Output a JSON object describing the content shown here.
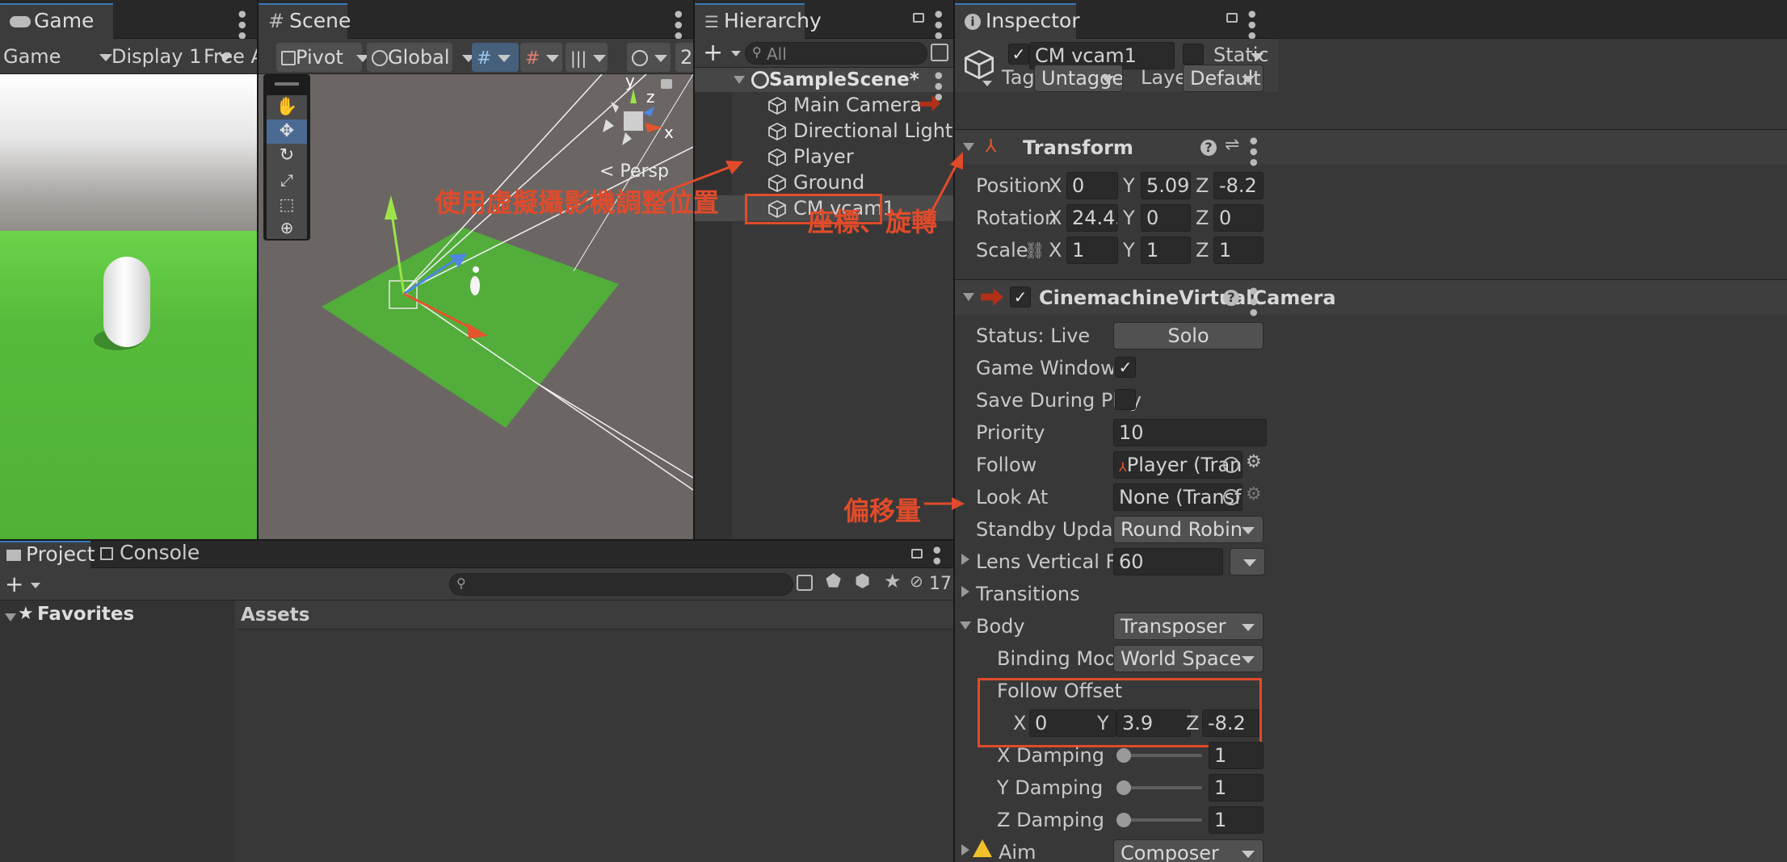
{
  "game": {
    "tab": "Game",
    "mode": "Game",
    "display": "Display 1",
    "aspect": "Free Asp"
  },
  "scene": {
    "tab": "Scene",
    "pivot": "Pivot",
    "space": "Global",
    "mode_2d": "2",
    "persp_label": "< Persp",
    "gizmo_axes": {
      "x": "x",
      "y": "y",
      "z": "z"
    }
  },
  "hierarchy": {
    "tab": "Hierarchy",
    "search_placeholder": "All",
    "scene_name": "SampleScene*",
    "items": [
      {
        "label": "Main Camera"
      },
      {
        "label": "Directional Light"
      },
      {
        "label": "Player"
      },
      {
        "label": "Ground"
      },
      {
        "label": "CM vcam1"
      }
    ]
  },
  "inspector": {
    "tab": "Inspector",
    "object_name": "CM vcam1",
    "static_label": "Static",
    "tag_label": "Tag",
    "tag_value": "Untagged",
    "layer_label": "Layer",
    "layer_value": "Default",
    "transform": {
      "title": "Transform",
      "position_label": "Position",
      "rotation_label": "Rotation",
      "scale_label": "Scale",
      "position": {
        "x": "0",
        "y": "5.0999",
        "z": "-8.2"
      },
      "rotation": {
        "x": "24.45",
        "y": "0",
        "z": "0"
      },
      "scale": {
        "x": "1",
        "y": "1",
        "z": "1"
      },
      "axis_x": "X",
      "axis_y": "Y",
      "axis_z": "Z"
    },
    "vcam": {
      "title": "CinemachineVirtualCamera",
      "status_label": "Status: Live",
      "solo_label": "Solo",
      "game_window_guides_label": "Game Window Guides",
      "save_during_play_label": "Save During Play",
      "priority_label": "Priority",
      "priority_value": "10",
      "follow_label": "Follow",
      "follow_value": "Player (Transform)",
      "look_at_label": "Look At",
      "look_at_value": "None (Transform)",
      "standby_label": "Standby Update",
      "standby_value": "Round Robin",
      "fov_label": "Lens Vertical FOV",
      "fov_value": "60",
      "transitions_label": "Transitions",
      "body_label": "Body",
      "body_value": "Transposer",
      "binding_label": "Binding Mode",
      "binding_value": "World Space",
      "follow_offset_label": "Follow Offset",
      "follow_offset": {
        "x": "0",
        "y": "3.9",
        "z": "-8.2"
      },
      "x_damping_label": "X Damping",
      "y_damping_label": "Y Damping",
      "z_damping_label": "Z Damping",
      "x_damping": "1",
      "y_damping": "1",
      "z_damping": "1",
      "aim_label": "Aim",
      "aim_value": "Composer"
    }
  },
  "project": {
    "tab_project": "Project",
    "tab_console": "Console",
    "favorites_label": "Favorites",
    "assets_label": "Assets",
    "hidden_count": "17"
  },
  "annotations": {
    "vcam_position": "使用虛擬攝影機調整位置",
    "coords_rotation": "座標、旋轉",
    "offset": "偏移量"
  },
  "colors": {
    "annotation_red": "#e04b2b",
    "tab_accent": "#3a79bb",
    "ground_green": "#5bb83f",
    "sky_top": "#ffffff",
    "horizon_gray": "#7d7875"
  }
}
